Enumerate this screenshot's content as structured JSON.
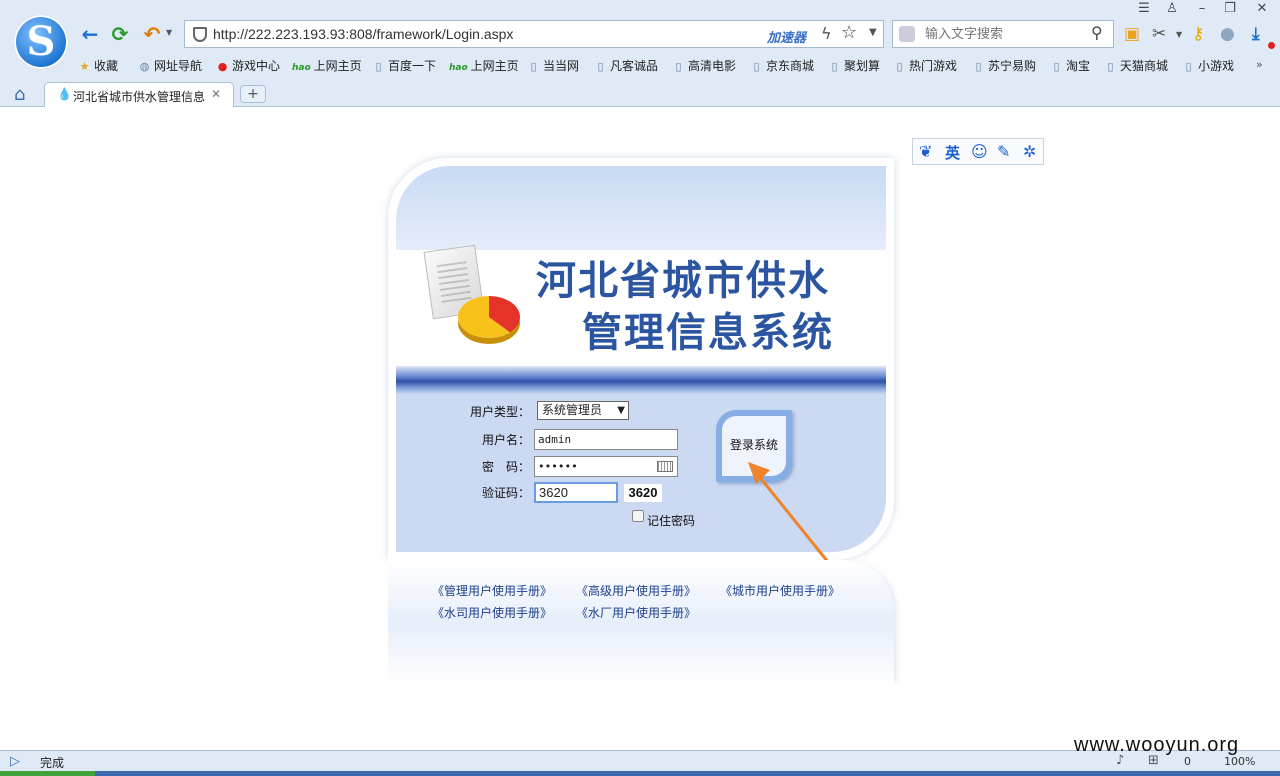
{
  "browser": {
    "logo_letter": "S",
    "url": "http://222.223.193.93:808/framework/Login.aspx",
    "accelerator_label": "加速器",
    "search_placeholder": "输入文字搜索",
    "tab_title": "河北省城市供水管理信息",
    "new_tab": "+",
    "bookmarks": [
      {
        "label": "收藏",
        "icon": "star-icon"
      },
      {
        "label": "网址导航",
        "icon": "globe-icon"
      },
      {
        "label": "游戏中心",
        "icon": "game-icon"
      },
      {
        "label": "上网主页",
        "icon": "hao-icon"
      },
      {
        "label": "百度一下",
        "icon": "page-icon"
      },
      {
        "label": "上网主页",
        "icon": "hao-icon"
      },
      {
        "label": "当当网",
        "icon": "page-icon"
      },
      {
        "label": "凡客诚品",
        "icon": "page-icon"
      },
      {
        "label": "高清电影",
        "icon": "page-icon"
      },
      {
        "label": "京东商城",
        "icon": "page-icon"
      },
      {
        "label": "聚划算",
        "icon": "page-icon"
      },
      {
        "label": "热门游戏",
        "icon": "page-icon"
      },
      {
        "label": "苏宁易购",
        "icon": "page-icon"
      },
      {
        "label": "淘宝",
        "icon": "page-icon"
      },
      {
        "label": "天猫商城",
        "icon": "page-icon"
      },
      {
        "label": "小游戏",
        "icon": "page-icon"
      }
    ],
    "hao_prefix": "hao"
  },
  "ime_toolbar": [
    "paw-icon",
    "英",
    "smile-icon",
    "pen-icon",
    "gear-icon"
  ],
  "login": {
    "title_line1": "河北省城市供水",
    "title_line2": "管理信息系统",
    "user_type_label": "用户类型：",
    "user_type_value": "系统管理员",
    "username_label": "用户名：",
    "username_value": "admin",
    "password_label": "密　码：",
    "password_value": "••••••",
    "captcha_label": "验证码：",
    "captcha_input": "3620",
    "captcha_image": "3620",
    "remember_label": "记住密码",
    "login_button": "登录系统"
  },
  "manuals": [
    "《管理用户使用手册》",
    "《高级用户使用手册》",
    "《城市用户使用手册》",
    "《水司用户使用手册》",
    "《水厂用户使用手册》"
  ],
  "status": {
    "text": "完成",
    "count": "0",
    "zoom": "100%",
    "watermark": "www.wooyun.org"
  },
  "colors": {
    "title_blue": "#2b55a0",
    "arrow_orange": "#f0822a",
    "form_bg": "#cbd9f2"
  }
}
